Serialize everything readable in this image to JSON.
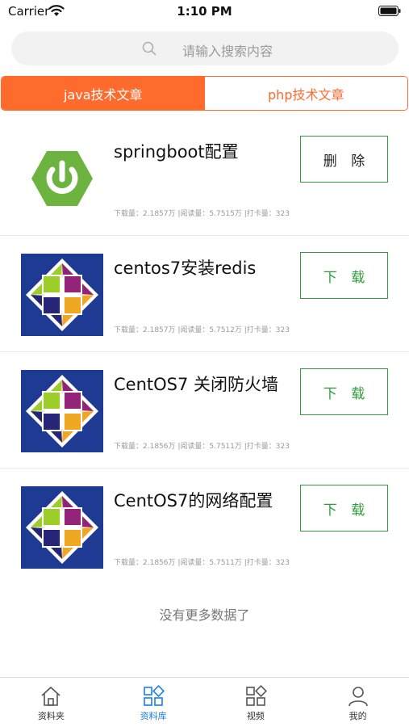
{
  "status_bar": {
    "carrier": "Carrier",
    "time": "1:10 PM"
  },
  "search": {
    "placeholder": "请输入搜索内容",
    "icon": "search-icon"
  },
  "tabs": [
    {
      "label": "java技术文章",
      "active": true
    },
    {
      "label": "php技术文章",
      "active": false
    }
  ],
  "articles": [
    {
      "title": "springboot配置",
      "action": "删 除",
      "icon": "spring-logo",
      "meta": "下载量：2.1857万 |阅读量：5.7515万 |打卡量：323"
    },
    {
      "title": "centos7安装redis",
      "action": "下 载",
      "icon": "centos-logo",
      "meta": "下载量：2.1857万 |阅读量：5.7512万 |打卡量：323"
    },
    {
      "title": "CentOS7 关闭防火墙",
      "action": "下 载",
      "icon": "centos-logo",
      "meta": "下载量：2.1856万 |阅读量：5.7511万 |打卡量：323"
    },
    {
      "title": "CentOS7的网络配置",
      "action": "下 载",
      "icon": "centos-logo",
      "meta": "下载量：2.1856万 |阅读量：5.7511万 |打卡量：323"
    }
  ],
  "footer": {
    "no_more": "没有更多数据了"
  },
  "tabbar": [
    {
      "label": "资料夹",
      "icon": "home-icon",
      "active": false
    },
    {
      "label": "资料库",
      "icon": "grid-icon",
      "active": true
    },
    {
      "label": "视频",
      "icon": "grid-icon",
      "active": false
    },
    {
      "label": "我的",
      "icon": "user-icon",
      "active": false
    }
  ],
  "colors": {
    "accent": "#ff6a2d",
    "action_green": "#2e9d3a",
    "tab_active_blue": "#1a7fe0"
  }
}
